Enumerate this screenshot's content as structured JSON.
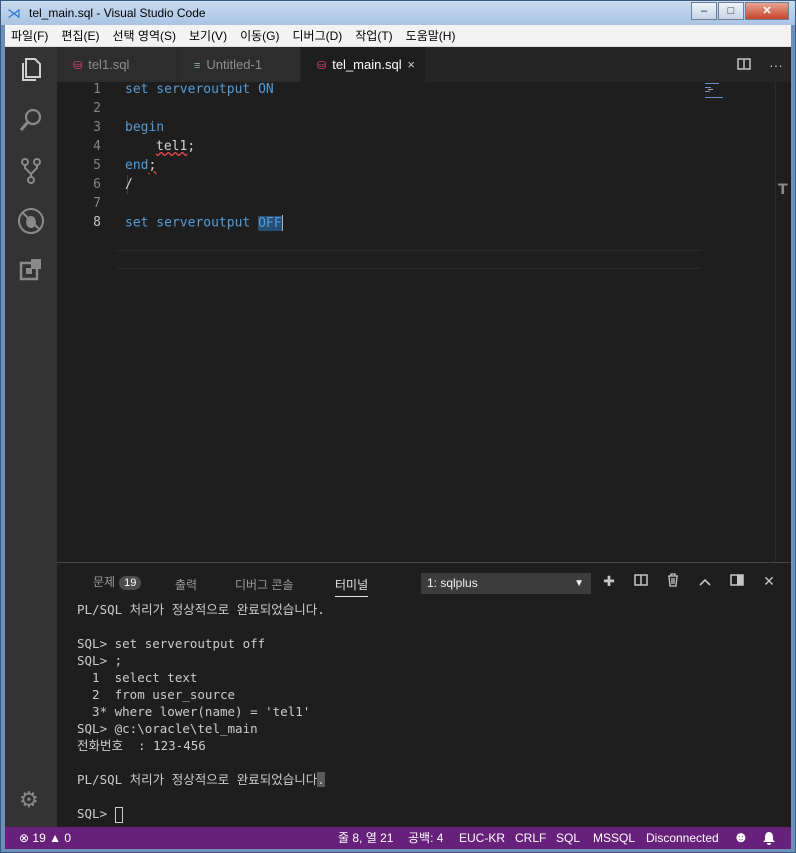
{
  "window": {
    "title": "tel_main.sql - Visual Studio Code",
    "btn_min": "‒",
    "btn_max": "□",
    "btn_close": "✕"
  },
  "menu": [
    "파일(F)",
    "편집(E)",
    "선택 영역(S)",
    "보기(V)",
    "이동(G)",
    "디버그(D)",
    "작업(T)",
    "도움말(H)"
  ],
  "tabs": [
    {
      "label": "tel1.sql"
    },
    {
      "label": "Untitled-1"
    },
    {
      "label": "tel_main.sql",
      "close": "×"
    }
  ],
  "editor": {
    "line_numbers": [
      "1",
      "2",
      "3",
      "4",
      "5",
      "6",
      "7",
      "8"
    ],
    "l1a": "set serveroutput ",
    "l1b": "ON",
    "l3": "begin",
    "l4": "tel1",
    "l4b": ";",
    "l5a": "end",
    "l5b": ";",
    "l6": "/",
    "l8a": "set serveroutput ",
    "l8b": "OFF"
  },
  "panel": {
    "tabs": {
      "problems": "문제",
      "problems_count": "19",
      "output": "출력",
      "debug_console": "디버그 콘솔",
      "terminal": "터미널"
    },
    "terminal_select": "1: sqlplus",
    "terminal_lines": [
      "PL/SQL 처리가 정상적으로 완료되었습니다.",
      "",
      "SQL> set serveroutput off",
      "SQL> ;",
      "  1  select text",
      "  2  from user_source",
      "  3* where lower(name) = 'tel1'",
      "SQL> @c:\\oracle\\tel_main",
      "전화번호  : 123-456",
      ""
    ],
    "last_msg_a": "PL/SQL 처리가 정상적으로 완료되었습니다",
    "last_msg_b": ".",
    "prompt": "SQL> "
  },
  "status": {
    "errors": "19",
    "warnings": "0",
    "position": "줄 8, 열 21",
    "spaces": "공백: 4",
    "encoding": "EUC-KR",
    "eol": "CRLF",
    "language": "SQL",
    "server": "MSSQL",
    "connection": "Disconnected"
  },
  "colors": {
    "status_bar": "#68217a",
    "keyword": "#569cd6",
    "sql_icon": "#e04a76"
  }
}
